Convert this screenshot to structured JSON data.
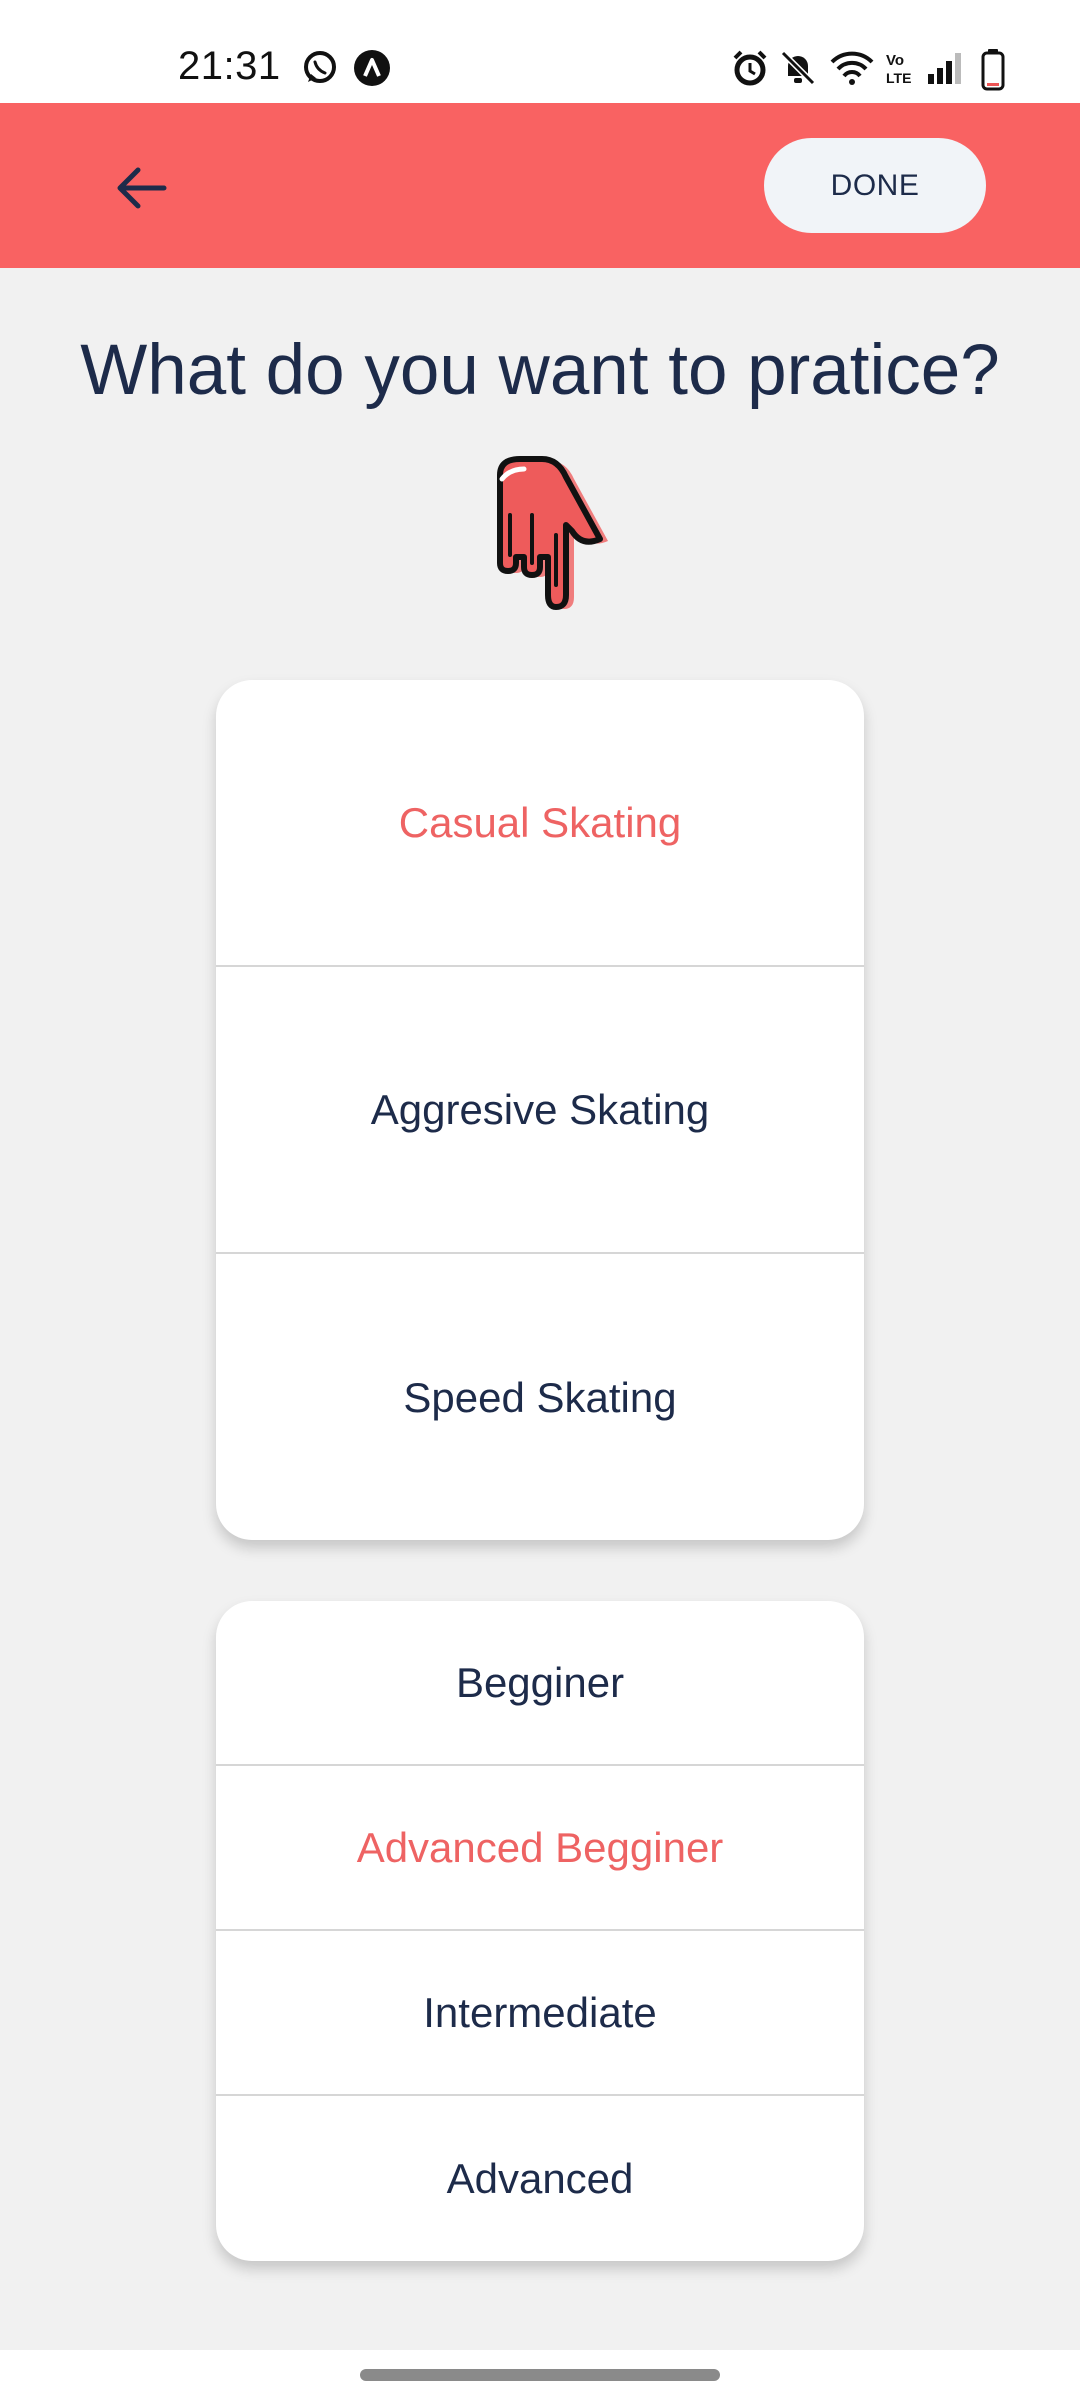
{
  "status_bar": {
    "time": "21:31",
    "left_icons": [
      "whatsapp-icon",
      "app-notification-icon"
    ],
    "right_icons": [
      "alarm-icon",
      "bell-muted-icon",
      "wifi-icon",
      "volte-icon",
      "signal-icon",
      "battery-icon"
    ]
  },
  "app_bar": {
    "background": "#f96262",
    "back_icon": "arrow-left-icon",
    "done_label": "DONE"
  },
  "page": {
    "title": "What do you want to pratice?",
    "pointer_icon": "hand-pointing-down-icon"
  },
  "skating_types": {
    "items": [
      {
        "label": "Casual Skating",
        "selected": true
      },
      {
        "label": "Aggresive Skating",
        "selected": false
      },
      {
        "label": "Speed Skating",
        "selected": false
      }
    ]
  },
  "levels": {
    "items": [
      {
        "label": "Begginer",
        "selected": false
      },
      {
        "label": "Advanced Begginer",
        "selected": true
      },
      {
        "label": "Intermediate",
        "selected": false
      },
      {
        "label": "Advanced",
        "selected": false
      }
    ]
  },
  "colors": {
    "accent": "#f96262",
    "selected_text": "#ee6363",
    "text": "#1d2b4a",
    "background": "#f1f1f1"
  }
}
